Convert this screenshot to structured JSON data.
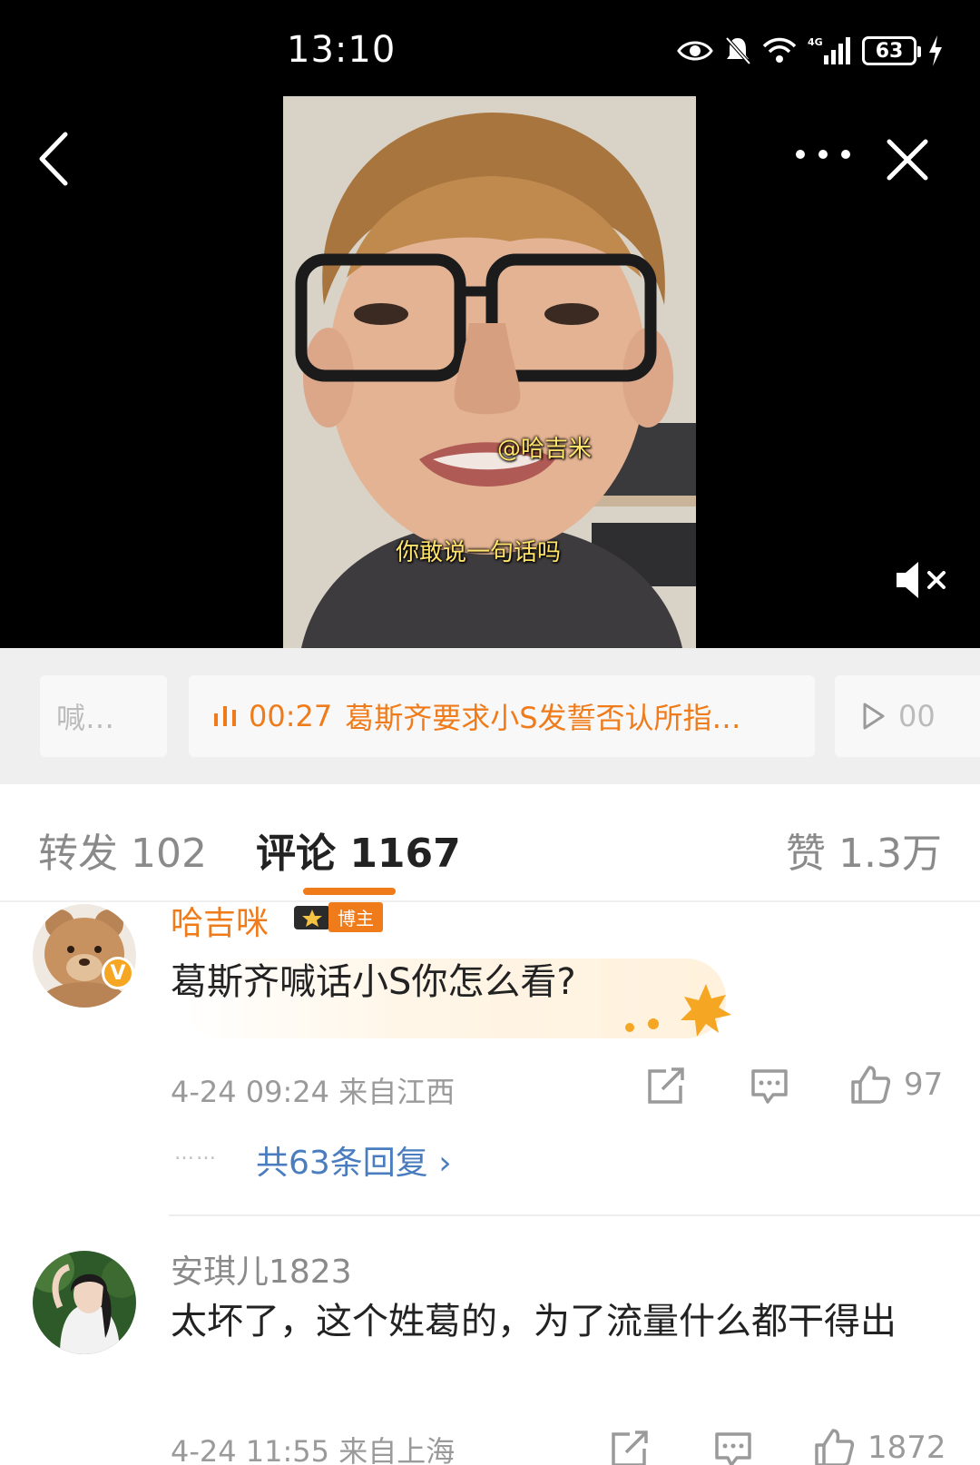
{
  "status_bar": {
    "time": "13:10",
    "battery": "63",
    "network": "4G"
  },
  "video": {
    "subtitle_mention": "@哈吉米",
    "subtitle_line": "你敢说一句话吗"
  },
  "chapters": {
    "prev_label": "喊…",
    "current_time": "00:27",
    "current_title": "葛斯齐要求小S发誓否认所指…",
    "next_label": "00"
  },
  "tabs": {
    "repost": "转发 102",
    "comment": "评论 1167",
    "like": "赞 1.3万"
  },
  "comments": [
    {
      "username": "哈吉咪",
      "badge": "博主",
      "text": "葛斯齐喊话小S你怎么看?",
      "meta": "4-24 09:24 来自江西",
      "likes": "97",
      "replies_dots": "……",
      "replies": "共63条回复 ›"
    },
    {
      "username": "安琪儿1823",
      "text": "太坏了，这个姓葛的，为了流量什么都干得出",
      "meta": "4-24 11:55 来自上海",
      "likes": "1872"
    }
  ],
  "colors": {
    "accent": "#f07b1a",
    "link": "#4a7dbf",
    "muted": "#9a9a9a"
  },
  "icons": [
    "back-arrow-icon",
    "more-icon",
    "close-icon",
    "mute-icon",
    "share-icon",
    "comment-icon",
    "like-icon",
    "equalizer-icon",
    "play-icon"
  ]
}
